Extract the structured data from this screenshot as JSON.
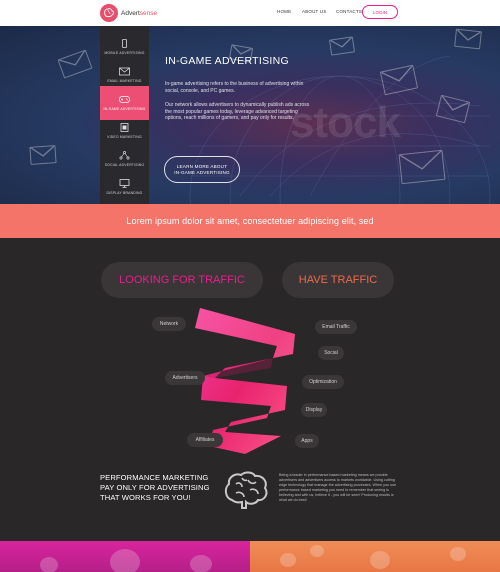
{
  "header": {
    "logo_main": "Advert",
    "logo_accent": "sense",
    "nav": [
      "HOME",
      "ABOUT US",
      "CONTACTS"
    ],
    "login": "LOGIN"
  },
  "hero": {
    "watermark": "stock",
    "side_menu": [
      {
        "label": "MOBILE ADVERTISING",
        "icon": "mobile-icon"
      },
      {
        "label": "EMAIL MARKETING",
        "icon": "envelope-icon"
      },
      {
        "label": "IN-GAME ADVERTISING",
        "icon": "gamepad-icon",
        "active": true
      },
      {
        "label": "VIDEO MARKETING",
        "icon": "video-icon"
      },
      {
        "label": "SOCIAL ADVERTISING",
        "icon": "share-icon"
      },
      {
        "label": "DISPLAY BRANDING",
        "icon": "monitor-icon"
      }
    ],
    "title": "IN-GAME ADVERTISING",
    "p1": "In-game advertising refers to the business of advertising within social, console, and PC games.",
    "p2": "Our network allows advertisers to dynamically publish ads across the most popular games today, leverage advanced targeting options, reach millions of gamers, and pay only for results.",
    "button_line1": "LEARN MORE ABOUT",
    "button_line2": "IN-GAME ADVERTISING"
  },
  "banner": {
    "text": "Lorem ipsum dolor sit amet, consectetuer adipiscing elit, sed"
  },
  "traffic": {
    "looking": "LOOKING FOR TRAFFIC",
    "have": "HAVE TRAFFIC",
    "left_tags": [
      "Network",
      "Advertisers",
      "Affiliates"
    ],
    "right_tags": [
      "Email Traffic",
      "Social",
      "Optimization",
      "Display",
      "Apps"
    ]
  },
  "performance": {
    "line1": "PERFORMANCE MARKETING",
    "line2": "PAY ONLY FOR ADVERTISING",
    "line3": "THAT WORKS FOR YOU!",
    "body": "Being a leader in performance based marketing means we provide advertisers and advertisers access to markets worldwide. Using cutting edge technology that manage the advertising processes. When you use performance based marketing you need to remember that seeing is believing and with us, believe it - you will be seen! Producing results is what we do best!"
  },
  "colors": {
    "accent_pink": "#ec4f73",
    "salmon": "#f47469",
    "dark": "#2a2728",
    "magenta": "#d9249e",
    "orange": "#f08c57"
  }
}
